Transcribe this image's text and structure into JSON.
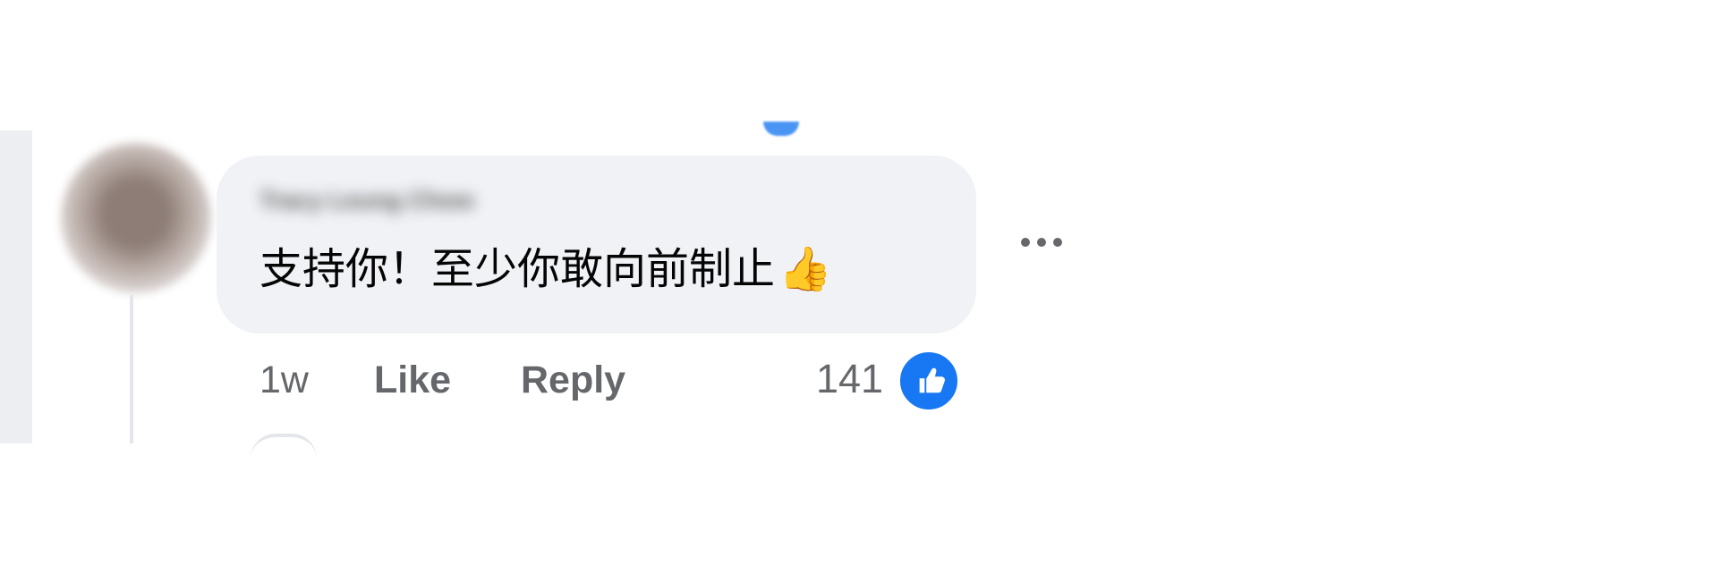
{
  "comment": {
    "author_name": "Tracy Leung Chow",
    "text": "支持你！至少你敢向前制止",
    "emoji": "👍",
    "time_ago": "1w",
    "like_label": "Like",
    "reply_label": "Reply",
    "reaction_count": "141"
  },
  "icons": {
    "avatar": "blurred-profile-avatar",
    "reaction": "thumbs-up-like-icon",
    "more": "more-options-icon",
    "top_reaction_peek": "partial-reaction-icon"
  },
  "colors": {
    "background": "#ffffff",
    "comment_bubble": "#f0f2f5",
    "secondary_text": "#65676b",
    "facebook_blue": "#1877f2",
    "thread_line": "#e4e6eb"
  }
}
